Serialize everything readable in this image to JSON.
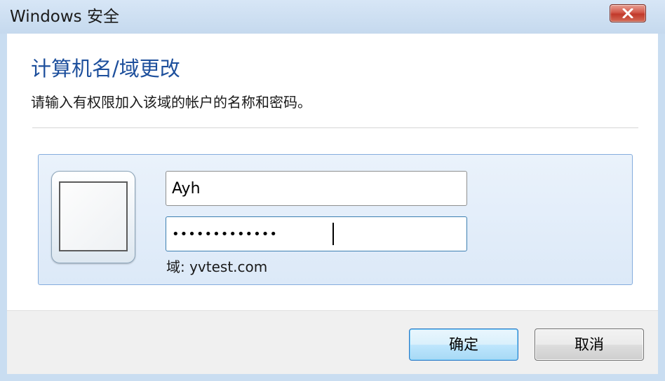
{
  "window": {
    "title": "Windows 安全",
    "close_icon": "close-icon"
  },
  "dialog": {
    "heading": "计算机名/域更改",
    "subheading": "请输入有权限加入该域的帐户的名称和密码。"
  },
  "credentials": {
    "user_tile_icon": "user-tile-icon",
    "username_value": "Ayh",
    "password_value": "•••••••••••••",
    "domain_text": "域: yvtest.com"
  },
  "buttons": {
    "ok_label": "确定",
    "cancel_label": "取消"
  },
  "colors": {
    "heading": "#1d4f9c",
    "panel_border": "#84acdd",
    "close_button": "#c1392b"
  }
}
